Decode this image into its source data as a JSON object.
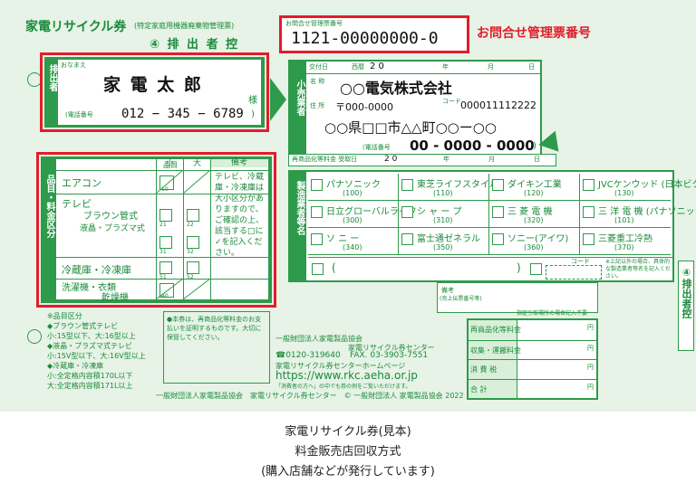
{
  "header": {
    "title": "家電リサイクル券",
    "title_sub": "(特定家庭用機器廃棄物管理票)",
    "copy_label": "④ 排 出 者 控",
    "inquiry_label": "お問合せ管理票番号",
    "inquiry_number": "1121-00000000-0",
    "inquiry_callout": "お問合せ管理票番号"
  },
  "discharger": {
    "side_label": "排出者",
    "name_label": "おなまえ",
    "name": "家 電 太 郎",
    "honorific": "様",
    "phone_label": "(電話番号",
    "phone": "012 − 345 − 6789",
    "phone_close": ")"
  },
  "retailer": {
    "side_label": "小売業者",
    "date_label": "交付日",
    "era": "西暦",
    "year_prefix": "2 0",
    "year_unit": "年",
    "month_unit": "月",
    "day_unit": "日",
    "name_label": "名 称",
    "name": "○○電気株式会社",
    "address_label": "住 所",
    "postal": "〒000-0000",
    "code_label": "コード",
    "code": "000011112222",
    "address": "○○県□□市△△町○○ー○○",
    "phone_label": "(電話番号",
    "phone": "00 - 0000 - 0000",
    "phone_close": ")",
    "fee_date_label": "再商品化等料金 受取日",
    "fee_year": "2 0",
    "fee_year_unit": "年",
    "fee_month_unit": "月",
    "fee_day_unit": "日"
  },
  "categories": {
    "side_label": "品目・料金区分",
    "col_item": "品目",
    "col_small": "小",
    "col_large": "大",
    "col_note": "備考",
    "rows": [
      {
        "name": "エアコン",
        "sub": "",
        "code": "10"
      },
      {
        "name": "テレビ",
        "sub": "ブラウン管式",
        "sub2": "液晶・プラズマ式",
        "code": "",
        "codes": [
          "21",
          "22",
          "31",
          "32"
        ]
      },
      {
        "name": "冷蔵庫・冷凍庫",
        "sub": "",
        "code": "",
        "codes": [
          "51",
          "52"
        ]
      },
      {
        "name": "洗濯機・衣類",
        "sub": "乾燥機",
        "code": "40"
      }
    ],
    "note": "テレビ、冷蔵庫・冷凍庫は大小区分がありますので、ご確認の上、該当する□に✓を記入ください。"
  },
  "manufacturers": {
    "side_label": "製造業者等名",
    "items": [
      {
        "name": "パナソニック",
        "code": "(100)"
      },
      {
        "name": "東芝ライフスタイル",
        "code": "(110)"
      },
      {
        "name": "ダイキン工業",
        "code": "(120)"
      },
      {
        "name": "JVCケンウッド (日本ビクター)",
        "code": "(130)"
      },
      {
        "name": "日立グローバルライフ",
        "code": "(300)"
      },
      {
        "name": "シ ャ ー プ",
        "code": "(310)"
      },
      {
        "name": "三 菱 電 機",
        "code": "(320)"
      },
      {
        "name": "三 洋 電 機 (パナソニック)",
        "code": "(101)"
      },
      {
        "name": "ソ ニ ー",
        "code": "(340)"
      },
      {
        "name": "富士通ゼネラル",
        "code": "(350)"
      },
      {
        "name": "ソニー(アイワ)",
        "code": "(360)"
      },
      {
        "name": "三菱重工冷熱",
        "code": "(370)"
      }
    ],
    "other_open": "(",
    "other_close": ")",
    "code_label": "コード",
    "other_note": "※上記以外の場合、具体的な製造業者等名を記入ください。"
  },
  "copy_tab": "④排出者控",
  "fees": {
    "note_label": "備考",
    "note_sub": "(売上伝票番号等)",
    "shipment_label": "指定引取場所の場合記入不要",
    "rows": [
      {
        "label": "再商品化等料金",
        "unit": "円"
      },
      {
        "label": "収集・運搬料金",
        "unit": "円"
      },
      {
        "label": "消 費 税",
        "unit": "円"
      },
      {
        "label": "合 計",
        "unit": "円"
      }
    ]
  },
  "footer": {
    "left_notes": [
      "※品目区分",
      "◆ブラウン管式テレビ",
      "小:15型以下、大:16型以上",
      "◆液晶・プラズマ式テレビ",
      "小:15V型以下、大:16V型以上",
      "◆冷蔵庫・冷凍庫",
      "小:全定格内容積170L以下",
      "大:全定格内容積171L以上"
    ],
    "mid_notes": "●本券は、再商品化等料金のお支払いを証明するものです。大切に保管してください。",
    "center_title": "一般財団法人家電製品協会",
    "center_subtitle": "家電リサイクル券センター",
    "phone": "☎0120-319640",
    "fax": "FAX. 03-3903-7551",
    "site_label": "家電リサイクル券センターホームページ",
    "url": "https://www.rkc.aeha.or.jp",
    "url_note": "「消費者の方へ」の中でも券の例をご覧いただけます。",
    "bottom_line": "一般財団法人家電製品協会　家電リサイクル券センター　© 一般財団法人 家電製品協会 2022"
  },
  "caption": {
    "line1": "家電リサイクル券(見本)",
    "line2": "料金販売店回収方式",
    "line3": "(購入店舗などが発行しています)"
  },
  "colors": {
    "green": "#1b8a3a",
    "red": "#e11d2a",
    "background": "#e6f3e6"
  }
}
